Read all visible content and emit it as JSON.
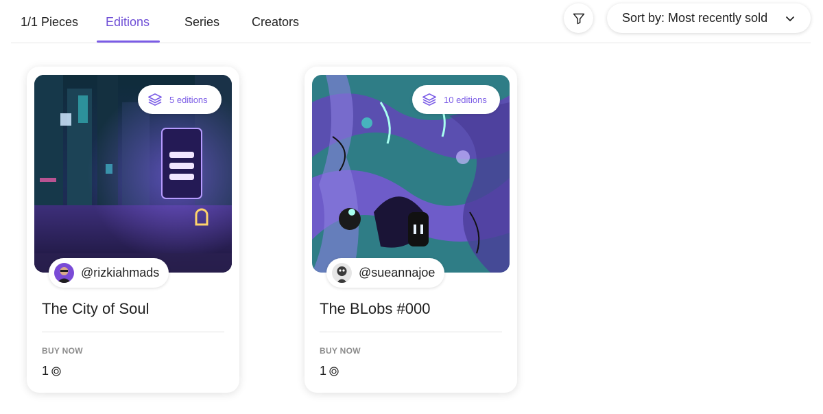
{
  "nav": {
    "tabs": [
      {
        "label": "1/1 Pieces",
        "active": false
      },
      {
        "label": "Editions",
        "active": true
      },
      {
        "label": "Series",
        "active": false
      },
      {
        "label": "Creators",
        "active": false
      }
    ],
    "filter_icon": "filter-icon",
    "sort_label": "Sort by: Most recently sold",
    "sort_icon": "chevron-down-icon"
  },
  "colors": {
    "accent": "#7b5ce6",
    "text": "#1f1f1f",
    "muted": "#8c8c8c"
  },
  "cards": [
    {
      "editions": "5 editions",
      "editions_icon": "layers-icon",
      "creator": "@rizkiahmads",
      "title": "The City of Soul",
      "buy_label": "BUY NOW",
      "price": "1",
      "currency_icon": "sol-coin-icon"
    },
    {
      "editions": "10 editions",
      "editions_icon": "layers-icon",
      "creator": "@sueannajoe",
      "title": "The BLobs #000",
      "buy_label": "BUY NOW",
      "price": "1",
      "currency_icon": "sol-coin-icon"
    }
  ]
}
